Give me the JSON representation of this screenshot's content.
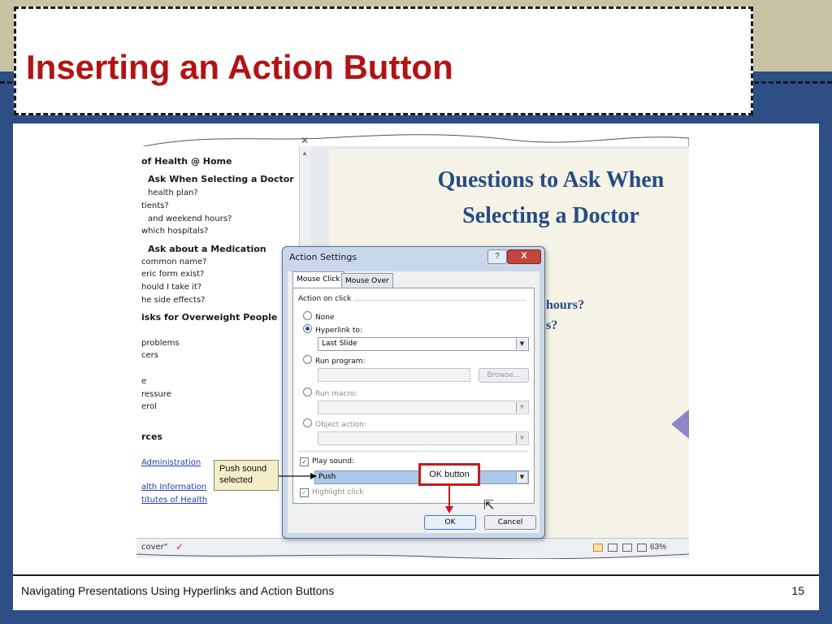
{
  "slide": {
    "title": "Inserting an Action Button",
    "footer_text": "Navigating Presentations Using Hyperlinks and Action Buttons",
    "page_number": "15"
  },
  "outline": {
    "lines": [
      {
        "text": "of Health @ Home",
        "kind": "heading"
      },
      {
        "text": "Ask When Selecting a Doctor",
        "kind": "heading"
      },
      {
        "text": "health plan?",
        "kind": "item"
      },
      {
        "text": "tients?",
        "kind": "item"
      },
      {
        "text": "and weekend hours?",
        "kind": "item"
      },
      {
        "text": "which hospitals?",
        "kind": "item"
      },
      {
        "text": "Ask about a Medication",
        "kind": "heading"
      },
      {
        "text": "common name?",
        "kind": "item"
      },
      {
        "text": "eric form exist?",
        "kind": "item"
      },
      {
        "text": "hould I take it?",
        "kind": "item"
      },
      {
        "text": "he side effects?",
        "kind": "item"
      },
      {
        "text": "isks for Overweight People",
        "kind": "heading"
      },
      {
        "text": "problems",
        "kind": "item"
      },
      {
        "text": "cers",
        "kind": "item"
      },
      {
        "text": "e",
        "kind": "item"
      },
      {
        "text": "ressure",
        "kind": "item"
      },
      {
        "text": "erol",
        "kind": "item"
      },
      {
        "text": "rces",
        "kind": "heading"
      },
      {
        "text": "Administration",
        "kind": "link"
      },
      {
        "text": "alth Information",
        "kind": "link"
      },
      {
        "text": "titutes of Health",
        "kind": "link"
      }
    ]
  },
  "preview": {
    "title_line1": "Questions to Ask When",
    "title_line2": "Selecting a Doctor",
    "visible_fragment1": "hours?",
    "visible_fragment2": "s?"
  },
  "statusbar": {
    "theme_text": "cover\"",
    "zoom": "63%"
  },
  "dialog": {
    "title": "Action Settings",
    "help_label": "?",
    "close_label": "X",
    "tabs": [
      "Mouse Click",
      "Mouse Over"
    ],
    "group_label": "Action on click",
    "options": {
      "none": "None",
      "hyperlink": "Hyperlink to:",
      "run_program": "Run program:",
      "run_macro": "Run macro:",
      "object_action": "Object action:"
    },
    "hyperlink_value": "Last Slide",
    "browse_label": "Browse...",
    "play_sound_label": "Play sound:",
    "sound_value": "Push",
    "highlight_label": "Highlight click",
    "ok_label": "OK",
    "cancel_label": "Cancel"
  },
  "callouts": {
    "push_sound": "Push sound selected",
    "ok_button": "OK button"
  },
  "colors": {
    "title": "#b31313",
    "background": "#2d4f86",
    "tan": "#c9c2a4",
    "callout_border": "#c41c1c",
    "slide_title": "#264b86"
  }
}
